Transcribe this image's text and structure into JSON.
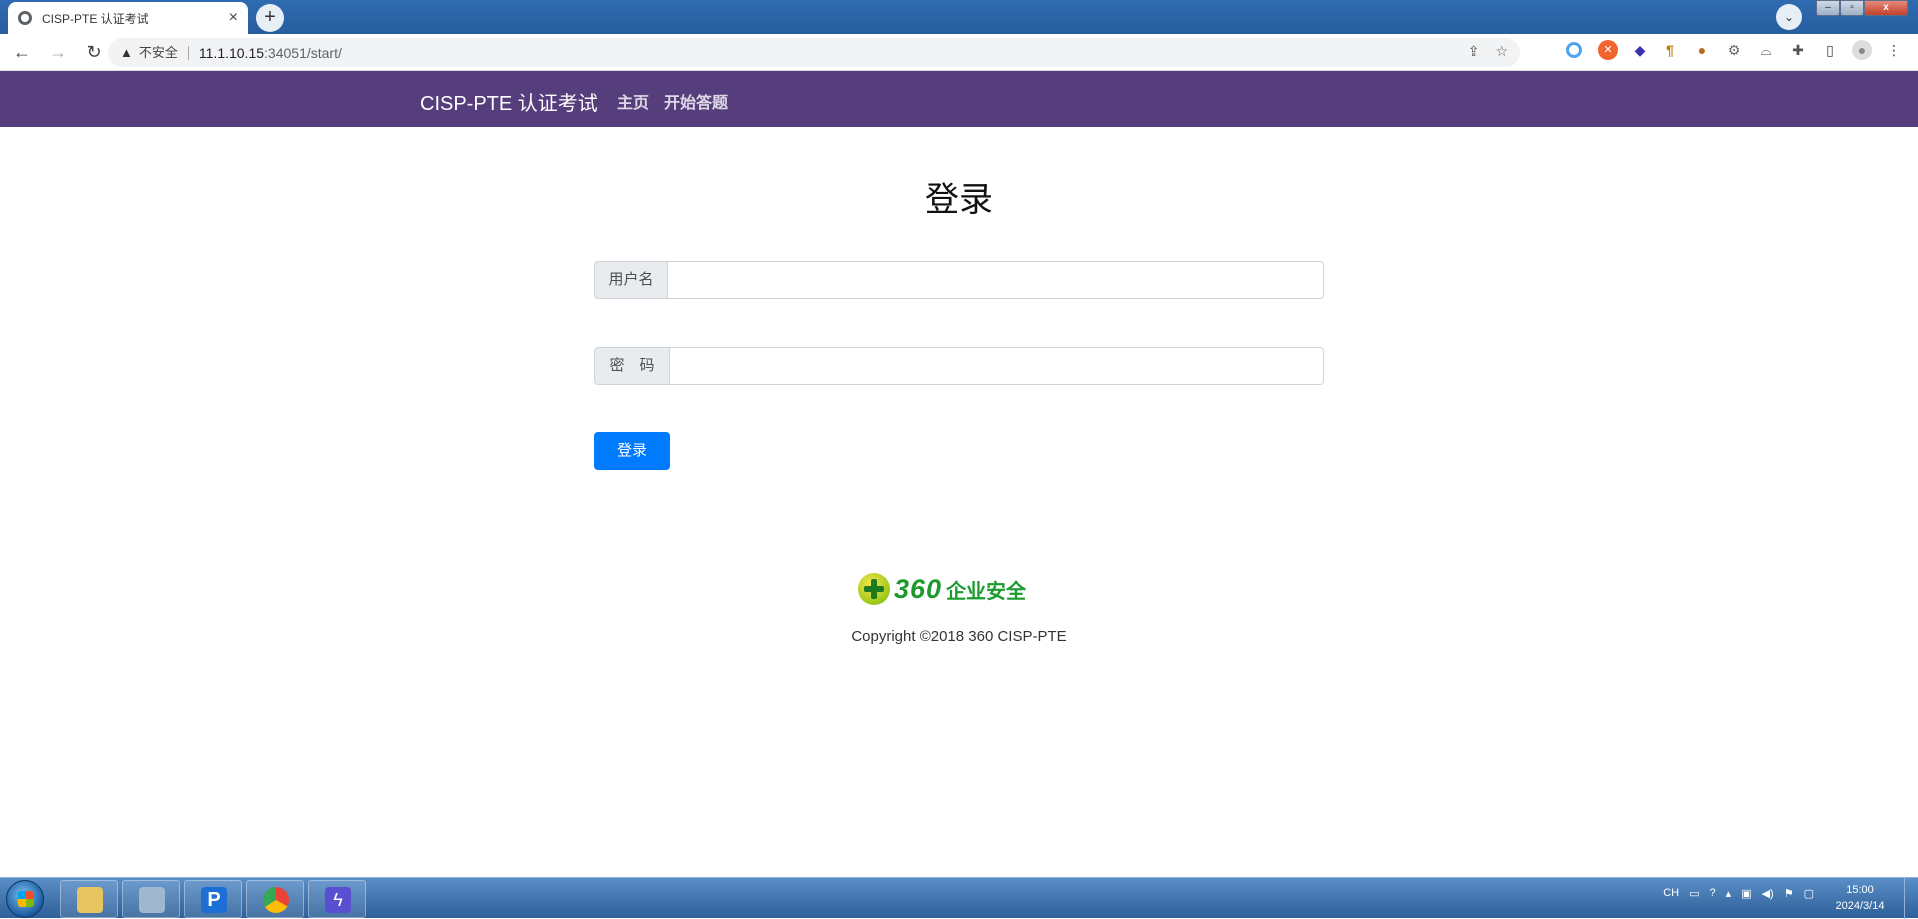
{
  "browser": {
    "tab_title": "CISP-PTE 认证考试",
    "tab_close": "×",
    "new_tab": "+",
    "security_label": "不安全",
    "url_host": "11.1.10.15",
    "url_rest": ":34051/start/"
  },
  "navbar": {
    "brand": "CISP-PTE 认证考试",
    "links": [
      "主页",
      "开始答题"
    ],
    "color": "#563d7c"
  },
  "login": {
    "title": "登录",
    "username_label": "用户名",
    "password_label": "密　码",
    "username_value": "",
    "password_value": "",
    "submit_label": "登录",
    "button_color": "#007bff"
  },
  "footer": {
    "logo_number": "360",
    "logo_text": "企业安全",
    "copyright": "Copyright ©2018 360 CISP-PTE"
  },
  "taskbar": {
    "lang": "CH",
    "time": "15:00",
    "date": "2024/3/14"
  }
}
